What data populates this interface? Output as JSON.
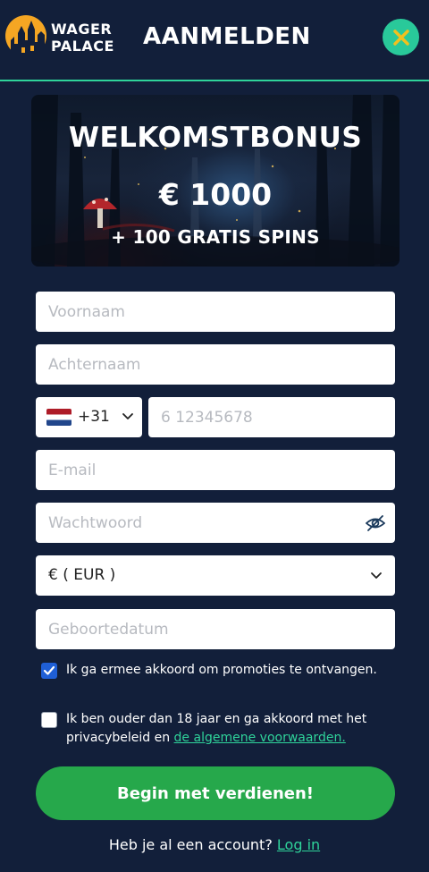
{
  "brand": {
    "logo_line1": "WAGER",
    "logo_line2": "PALACE"
  },
  "header": {
    "title": "AANMELDEN"
  },
  "banner": {
    "title": "WELKOMSTBONUS",
    "amount": "€ 1000",
    "spins": "+ 100 GRATIS SPINS"
  },
  "form": {
    "first_name": {
      "placeholder": "Voornaam",
      "value": ""
    },
    "last_name": {
      "placeholder": "Achternaam",
      "value": ""
    },
    "phone": {
      "country_code": "+31",
      "placeholder": "6 12345678",
      "value": ""
    },
    "email": {
      "placeholder": "E-mail",
      "value": ""
    },
    "password": {
      "placeholder": "Wachtwoord",
      "value": ""
    },
    "currency": {
      "selected": "€ ( EUR )"
    },
    "birthdate": {
      "placeholder": "Geboortedatum",
      "value": ""
    }
  },
  "consents": {
    "promotions": {
      "label": "Ik ga ermee akkoord om promoties te ontvangen.",
      "checked": true
    },
    "terms": {
      "label_prefix": "Ik ben ouder dan 18 jaar en ga akkoord met het privacybeleid en ",
      "link_text": "de algemene voorwaarden.",
      "checked": false
    }
  },
  "actions": {
    "submit_label": "Begin met verdienen!",
    "login_prompt": "Heb je al een account?",
    "login_link": "Log in"
  },
  "colors": {
    "background": "#121f3a",
    "accent": "#2fd39a",
    "submit": "#26a84b",
    "checkbox": "#1f5fd6",
    "logo": "#f5a623"
  },
  "icons": [
    "castle-logo-icon",
    "close-icon",
    "netherlands-flag-icon",
    "chevron-down-icon",
    "eye-slash-icon",
    "check-icon"
  ]
}
